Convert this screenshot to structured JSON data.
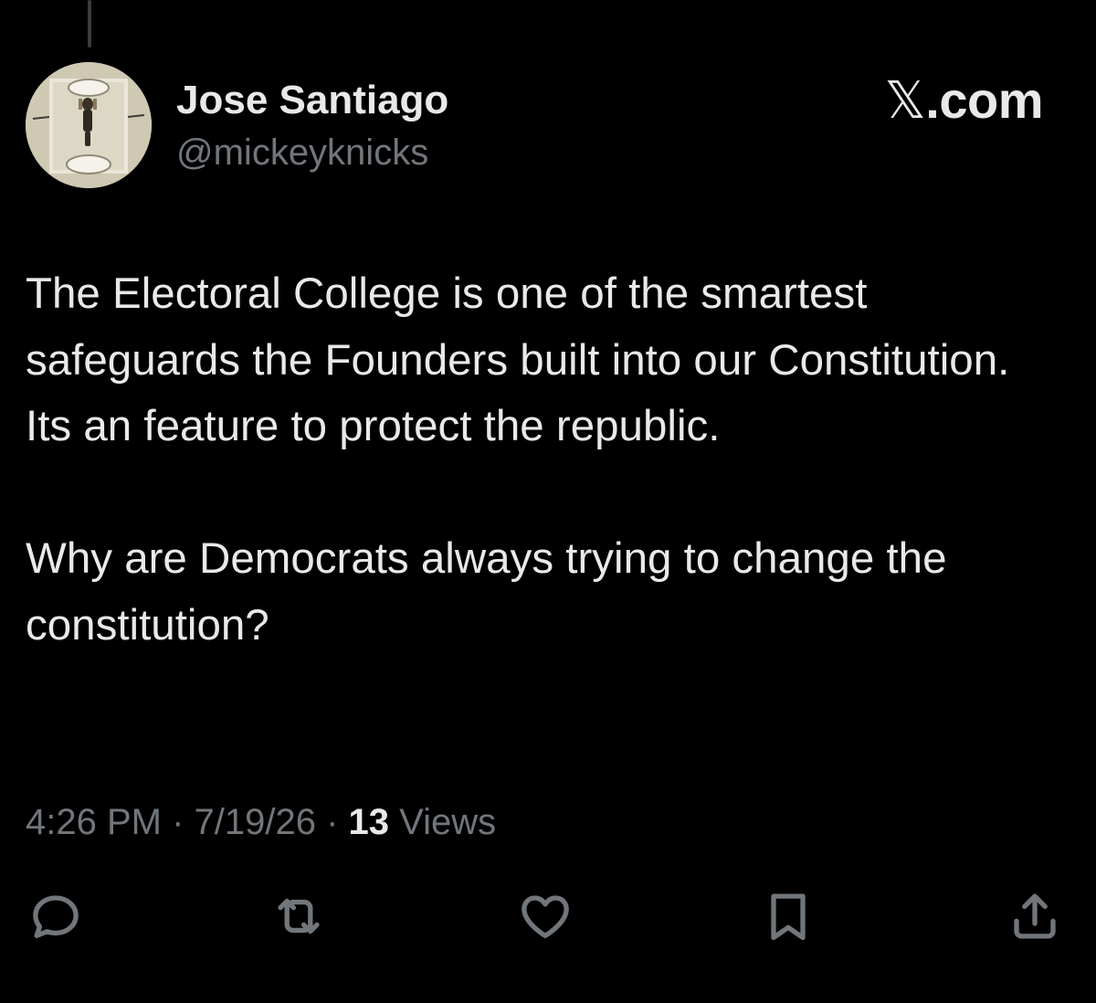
{
  "tweet": {
    "author": {
      "display_name": "Jose Santiago",
      "handle": "@mickeyknicks",
      "avatar_icon": "profile-photo"
    },
    "brand": {
      "x_glyph": "𝕏",
      "suffix": ".com"
    },
    "body": {
      "paragraph_1": "The Electoral College is one of the smartest safeguards the Founders built into our Constitution. Its an feature to protect the republic.",
      "paragraph_2": "Why are Democrats always trying to change the constitution?"
    },
    "meta": {
      "time": "4:26 PM",
      "separator": " · ",
      "date": "7/19/26",
      "views_count": "13",
      "views_label": " Views"
    },
    "actions": [
      {
        "name": "reply",
        "icon": "reply-icon"
      },
      {
        "name": "repost",
        "icon": "repost-icon"
      },
      {
        "name": "like",
        "icon": "heart-icon"
      },
      {
        "name": "bookmark",
        "icon": "bookmark-icon"
      },
      {
        "name": "share",
        "icon": "share-icon"
      }
    ],
    "colors": {
      "background": "#000000",
      "primary_text": "#e7e9ea",
      "secondary_text": "#71767b"
    }
  }
}
